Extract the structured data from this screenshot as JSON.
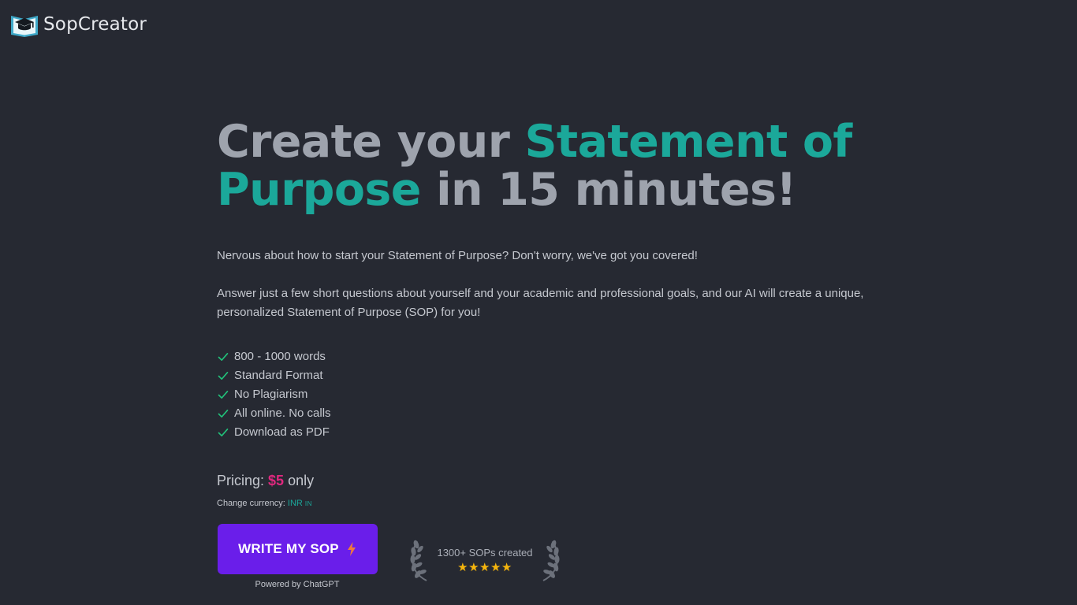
{
  "brand": {
    "name": "SopCreator",
    "icon": "graduation-cap-book-icon",
    "colors": {
      "logo_primary": "#3fa9c9",
      "logo_dark": "#14191f"
    }
  },
  "hero": {
    "part1": "Create your ",
    "accent1": "Statement of",
    "accent2": "Purpose",
    "part2": " in 15 minutes!"
  },
  "intro": {
    "p1": "Nervous about how to start your Statement of Purpose? Don't worry, we've got you covered!",
    "p2": "Answer just a few short questions about yourself and your academic and professional goals, and our AI will create a unique, personalized Statement of Purpose (SOP) for you!"
  },
  "features": [
    {
      "icon": "check-icon",
      "label": "800 - 1000 words"
    },
    {
      "icon": "check-icon",
      "label": "Standard Format"
    },
    {
      "icon": "check-icon",
      "label": "No Plagiarism"
    },
    {
      "icon": "check-icon",
      "label": "All online. No calls"
    },
    {
      "icon": "check-icon",
      "label": "Download as PDF"
    }
  ],
  "pricing": {
    "label": "Pricing:",
    "price": "$5",
    "suffix": "only",
    "currency_label": "Change currency:",
    "currency_link": "INR",
    "currency_flag": "IN"
  },
  "cta": {
    "label": "WRITE MY SOP",
    "icon": "lightning-bolt-icon",
    "powered_by": "Powered by ChatGPT"
  },
  "award": {
    "text": "1300+ SOPs created",
    "stars": "★★★★★",
    "rating": 5,
    "icon": "laurel-wreath-icon"
  },
  "colors": {
    "background": "#262932",
    "accent": "#1ba89a",
    "heading": "#9ea3ad",
    "price": "#e0287f",
    "button": "#6a1eea",
    "bolt": "#f07a3a",
    "check": "#21c27a",
    "star": "#f5b50d"
  }
}
